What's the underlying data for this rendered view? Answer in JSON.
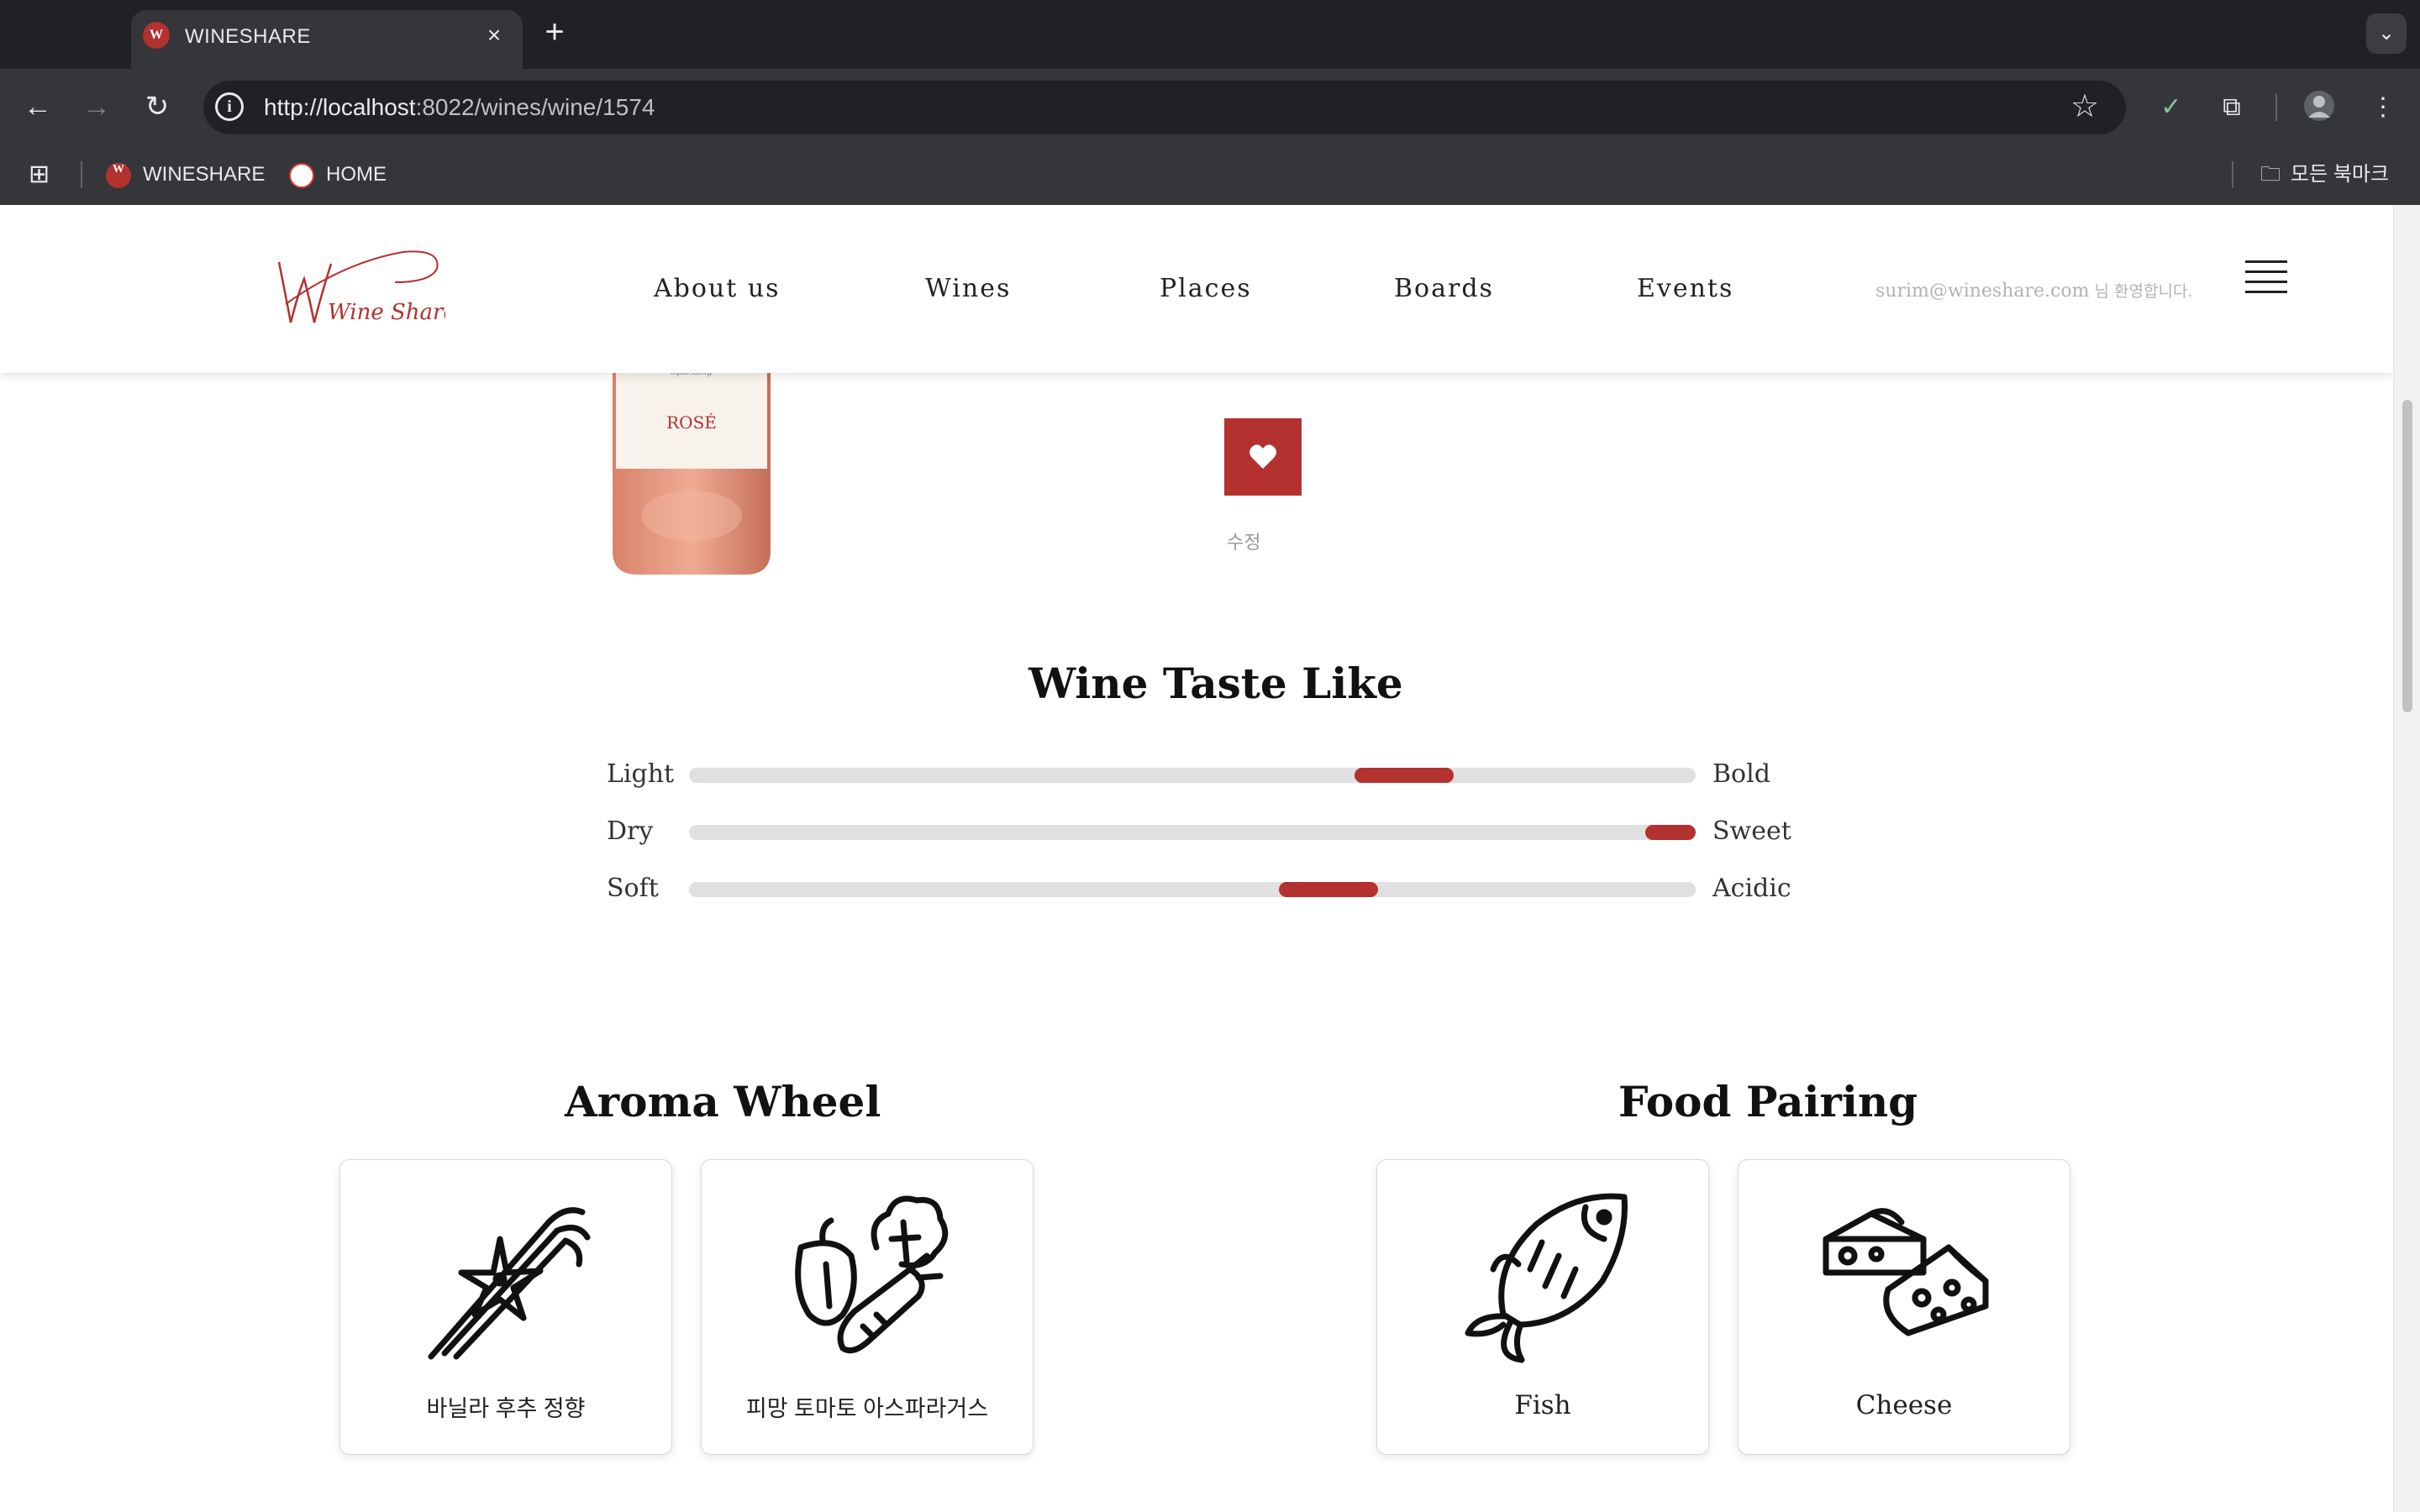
{
  "browser": {
    "tab_title": "WINESHARE",
    "tab_favicon": "W",
    "url_host": "http://localhost",
    "url_rest": ":8022/wines/wine/1574",
    "bookmarks": [
      {
        "label": "WINESHARE",
        "icon": "W"
      },
      {
        "label": "HOME"
      }
    ],
    "all_bookmarks_label": "모든 북마크"
  },
  "header": {
    "logo_text": "Wine Share",
    "nav": [
      "About us",
      "Wines",
      "Places",
      "Boards",
      "Events"
    ],
    "user_email": "surim@wineshare.com",
    "welcome_suffix": " 님 환영합니다."
  },
  "wine": {
    "bottle_label": "ROSÉ",
    "edit_label": "수정"
  },
  "taste": {
    "title": "Wine Taste Like",
    "scales": [
      {
        "left": "Light",
        "right": "Bold",
        "position": 0.71
      },
      {
        "left": "Dry",
        "right": "Sweet",
        "position": 0.975
      },
      {
        "left": "Soft",
        "right": "Acidic",
        "position": 0.635
      }
    ]
  },
  "aroma": {
    "title": "Aroma Wheel",
    "items": [
      {
        "label": "바닐라 후추 정향",
        "icon": "vanilla-icon"
      },
      {
        "label": "피망 토마토 아스파라거스",
        "icon": "vegetables-icon"
      }
    ]
  },
  "food": {
    "title": "Food Pairing",
    "items": [
      {
        "label": "Fish",
        "icon": "fish-icon"
      },
      {
        "label": "Cheese",
        "icon": "cheese-icon"
      }
    ]
  },
  "colors": {
    "accent": "#b3312f",
    "track": "#e0e0e0"
  }
}
